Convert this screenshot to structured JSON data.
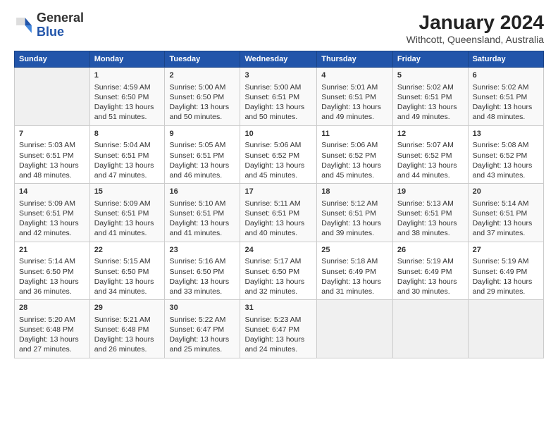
{
  "logo": {
    "general": "General",
    "blue": "Blue"
  },
  "title": "January 2024",
  "subtitle": "Withcott, Queensland, Australia",
  "headers": [
    "Sunday",
    "Monday",
    "Tuesday",
    "Wednesday",
    "Thursday",
    "Friday",
    "Saturday"
  ],
  "weeks": [
    [
      {
        "day": "",
        "sunrise": "",
        "sunset": "",
        "daylight": ""
      },
      {
        "day": "1",
        "sunrise": "Sunrise: 4:59 AM",
        "sunset": "Sunset: 6:50 PM",
        "daylight": "Daylight: 13 hours and 51 minutes."
      },
      {
        "day": "2",
        "sunrise": "Sunrise: 5:00 AM",
        "sunset": "Sunset: 6:50 PM",
        "daylight": "Daylight: 13 hours and 50 minutes."
      },
      {
        "day": "3",
        "sunrise": "Sunrise: 5:00 AM",
        "sunset": "Sunset: 6:51 PM",
        "daylight": "Daylight: 13 hours and 50 minutes."
      },
      {
        "day": "4",
        "sunrise": "Sunrise: 5:01 AM",
        "sunset": "Sunset: 6:51 PM",
        "daylight": "Daylight: 13 hours and 49 minutes."
      },
      {
        "day": "5",
        "sunrise": "Sunrise: 5:02 AM",
        "sunset": "Sunset: 6:51 PM",
        "daylight": "Daylight: 13 hours and 49 minutes."
      },
      {
        "day": "6",
        "sunrise": "Sunrise: 5:02 AM",
        "sunset": "Sunset: 6:51 PM",
        "daylight": "Daylight: 13 hours and 48 minutes."
      }
    ],
    [
      {
        "day": "7",
        "sunrise": "Sunrise: 5:03 AM",
        "sunset": "Sunset: 6:51 PM",
        "daylight": "Daylight: 13 hours and 48 minutes."
      },
      {
        "day": "8",
        "sunrise": "Sunrise: 5:04 AM",
        "sunset": "Sunset: 6:51 PM",
        "daylight": "Daylight: 13 hours and 47 minutes."
      },
      {
        "day": "9",
        "sunrise": "Sunrise: 5:05 AM",
        "sunset": "Sunset: 6:51 PM",
        "daylight": "Daylight: 13 hours and 46 minutes."
      },
      {
        "day": "10",
        "sunrise": "Sunrise: 5:06 AM",
        "sunset": "Sunset: 6:52 PM",
        "daylight": "Daylight: 13 hours and 45 minutes."
      },
      {
        "day": "11",
        "sunrise": "Sunrise: 5:06 AM",
        "sunset": "Sunset: 6:52 PM",
        "daylight": "Daylight: 13 hours and 45 minutes."
      },
      {
        "day": "12",
        "sunrise": "Sunrise: 5:07 AM",
        "sunset": "Sunset: 6:52 PM",
        "daylight": "Daylight: 13 hours and 44 minutes."
      },
      {
        "day": "13",
        "sunrise": "Sunrise: 5:08 AM",
        "sunset": "Sunset: 6:52 PM",
        "daylight": "Daylight: 13 hours and 43 minutes."
      }
    ],
    [
      {
        "day": "14",
        "sunrise": "Sunrise: 5:09 AM",
        "sunset": "Sunset: 6:51 PM",
        "daylight": "Daylight: 13 hours and 42 minutes."
      },
      {
        "day": "15",
        "sunrise": "Sunrise: 5:09 AM",
        "sunset": "Sunset: 6:51 PM",
        "daylight": "Daylight: 13 hours and 41 minutes."
      },
      {
        "day": "16",
        "sunrise": "Sunrise: 5:10 AM",
        "sunset": "Sunset: 6:51 PM",
        "daylight": "Daylight: 13 hours and 41 minutes."
      },
      {
        "day": "17",
        "sunrise": "Sunrise: 5:11 AM",
        "sunset": "Sunset: 6:51 PM",
        "daylight": "Daylight: 13 hours and 40 minutes."
      },
      {
        "day": "18",
        "sunrise": "Sunrise: 5:12 AM",
        "sunset": "Sunset: 6:51 PM",
        "daylight": "Daylight: 13 hours and 39 minutes."
      },
      {
        "day": "19",
        "sunrise": "Sunrise: 5:13 AM",
        "sunset": "Sunset: 6:51 PM",
        "daylight": "Daylight: 13 hours and 38 minutes."
      },
      {
        "day": "20",
        "sunrise": "Sunrise: 5:14 AM",
        "sunset": "Sunset: 6:51 PM",
        "daylight": "Daylight: 13 hours and 37 minutes."
      }
    ],
    [
      {
        "day": "21",
        "sunrise": "Sunrise: 5:14 AM",
        "sunset": "Sunset: 6:50 PM",
        "daylight": "Daylight: 13 hours and 36 minutes."
      },
      {
        "day": "22",
        "sunrise": "Sunrise: 5:15 AM",
        "sunset": "Sunset: 6:50 PM",
        "daylight": "Daylight: 13 hours and 34 minutes."
      },
      {
        "day": "23",
        "sunrise": "Sunrise: 5:16 AM",
        "sunset": "Sunset: 6:50 PM",
        "daylight": "Daylight: 13 hours and 33 minutes."
      },
      {
        "day": "24",
        "sunrise": "Sunrise: 5:17 AM",
        "sunset": "Sunset: 6:50 PM",
        "daylight": "Daylight: 13 hours and 32 minutes."
      },
      {
        "day": "25",
        "sunrise": "Sunrise: 5:18 AM",
        "sunset": "Sunset: 6:49 PM",
        "daylight": "Daylight: 13 hours and 31 minutes."
      },
      {
        "day": "26",
        "sunrise": "Sunrise: 5:19 AM",
        "sunset": "Sunset: 6:49 PM",
        "daylight": "Daylight: 13 hours and 30 minutes."
      },
      {
        "day": "27",
        "sunrise": "Sunrise: 5:19 AM",
        "sunset": "Sunset: 6:49 PM",
        "daylight": "Daylight: 13 hours and 29 minutes."
      }
    ],
    [
      {
        "day": "28",
        "sunrise": "Sunrise: 5:20 AM",
        "sunset": "Sunset: 6:48 PM",
        "daylight": "Daylight: 13 hours and 27 minutes."
      },
      {
        "day": "29",
        "sunrise": "Sunrise: 5:21 AM",
        "sunset": "Sunset: 6:48 PM",
        "daylight": "Daylight: 13 hours and 26 minutes."
      },
      {
        "day": "30",
        "sunrise": "Sunrise: 5:22 AM",
        "sunset": "Sunset: 6:47 PM",
        "daylight": "Daylight: 13 hours and 25 minutes."
      },
      {
        "day": "31",
        "sunrise": "Sunrise: 5:23 AM",
        "sunset": "Sunset: 6:47 PM",
        "daylight": "Daylight: 13 hours and 24 minutes."
      },
      {
        "day": "",
        "sunrise": "",
        "sunset": "",
        "daylight": ""
      },
      {
        "day": "",
        "sunrise": "",
        "sunset": "",
        "daylight": ""
      },
      {
        "day": "",
        "sunrise": "",
        "sunset": "",
        "daylight": ""
      }
    ]
  ]
}
